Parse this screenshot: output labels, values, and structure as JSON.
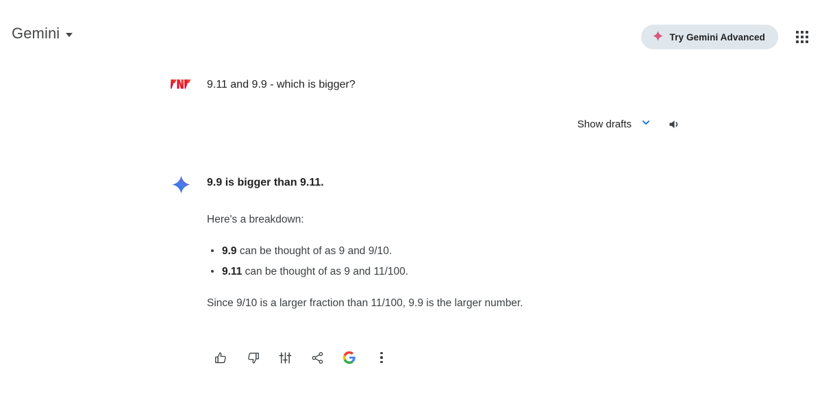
{
  "app": {
    "brand": "Gemini",
    "brand_caret_icon": "caret-down-icon"
  },
  "header": {
    "advanced_label": "Try Gemini Advanced",
    "advanced_icon": "sparkle-icon",
    "apps_icon": "apps-grid-icon",
    "pill_bg": "#dfe6ec",
    "sparkle_color": "#d9577f"
  },
  "conversation": {
    "user": {
      "avatar_icon": "user-avatar-logo",
      "prompt": "9.11 and 9.9 - which is bigger?"
    },
    "drafts": {
      "label": "Show drafts",
      "chevron_icon": "chevron-down-icon",
      "chevron_color": "#1a73e8",
      "speaker_icon": "speaker-volume-icon"
    },
    "model": {
      "avatar_icon": "gemini-sparkle-icon",
      "headline": "9.9 is bigger than 9.11.",
      "intro": "Here's a breakdown:",
      "points": [
        {
          "bold": "9.9",
          "rest": " can be thought of as 9 and 9/10."
        },
        {
          "bold": "9.11",
          "rest": " can be thought of as 9 and 11/100."
        }
      ],
      "closing": "Since 9/10 is a larger fraction than 11/100, 9.9 is the larger number."
    },
    "actions": [
      {
        "name": "thumb-up-icon",
        "label": "Good response"
      },
      {
        "name": "thumb-down-icon",
        "label": "Bad response"
      },
      {
        "name": "tune-icon",
        "label": "Modify response"
      },
      {
        "name": "share-icon",
        "label": "Share & export"
      },
      {
        "name": "google-g-icon",
        "label": "Google it"
      },
      {
        "name": "more-vert-icon",
        "label": "More"
      }
    ]
  }
}
